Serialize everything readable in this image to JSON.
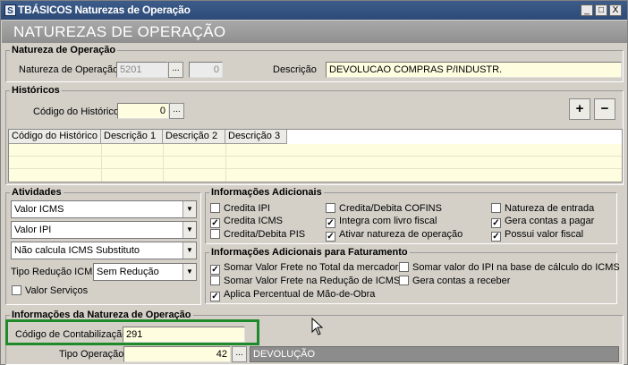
{
  "window": {
    "app_icon": "S",
    "title": "TBÁSICOS Naturezas de Operação",
    "minimize": "_",
    "maximize": "□",
    "close": "X"
  },
  "header": {
    "title": "NATUREZAS DE OPERAÇÃO"
  },
  "natureza": {
    "legend": "Natureza de Operação",
    "natureza_label": "Natureza de Operação",
    "natureza_value": "5201",
    "seq_value": "0",
    "descricao_label": "Descrição",
    "descricao_value": "DEVOLUCAO COMPRAS P/INDUSTR.",
    "ellipsis": "..."
  },
  "historicos": {
    "legend": "Históricos",
    "codigo_label": "Código do Histórico",
    "codigo_value": "0",
    "ellipsis": "...",
    "add_icon": "plus-icon",
    "remove_icon": "minus-icon",
    "add_symbol": "+",
    "remove_symbol": "−",
    "columns": [
      "Código do Histórico",
      "Descrição 1",
      "Descrição 2",
      "Descrição 3"
    ]
  },
  "atividades": {
    "legend": "Atividades",
    "combo1": "Valor ICMS",
    "combo2": "Valor IPI",
    "combo3": "Não calcula ICMS Substituto",
    "tipo_reducao_label": "Tipo Redução ICMS",
    "tipo_reducao_value": "Sem Redução",
    "valor_servicos_label": "Valor Serviços",
    "valor_servicos_checked": false
  },
  "info_adicionais": {
    "legend": "Informações Adicionais",
    "items": [
      {
        "label": "Credita IPI",
        "checked": false
      },
      {
        "label": "Credita ICMS",
        "checked": true
      },
      {
        "label": "Credita/Debita PIS",
        "checked": false
      },
      {
        "label": "Credita/Debita COFINS",
        "checked": false
      },
      {
        "label": "Integra com livro fiscal",
        "checked": true
      },
      {
        "label": "Ativar natureza de operação",
        "checked": true
      },
      {
        "label": "Natureza de entrada",
        "checked": false
      },
      {
        "label": "Gera contas a pagar",
        "checked": true
      },
      {
        "label": "Possui valor fiscal",
        "checked": true
      }
    ]
  },
  "info_faturamento": {
    "legend": "Informações Adicionais para Faturamento",
    "items": [
      {
        "label": "Somar Valor Frete no Total da mercadoria",
        "checked": true
      },
      {
        "label": "Somar Valor Frete na Redução de ICMS",
        "checked": false
      },
      {
        "label": "Aplica Percentual de Mão-de-Obra",
        "checked": true
      },
      {
        "label": "Somar valor do IPI na base de cálculo do ICMS",
        "checked": false
      },
      {
        "label": "Gera contas a receber",
        "checked": false
      }
    ]
  },
  "info_natureza": {
    "legend": "Informações da Natureza de Operação",
    "contabilizacao_label": "Código de Contabilização",
    "contabilizacao_value": "291",
    "tipo_operacao_label": "Tipo Operação",
    "tipo_operacao_value": "42",
    "tipo_operacao_desc": "DEVOLUÇÃO",
    "ellipsis": "..."
  },
  "colors": {
    "title_bar": "#2d4a78",
    "header_band": "#9a9a9a",
    "field_bg": "#fffde0",
    "highlight": "#1e8a2a"
  }
}
